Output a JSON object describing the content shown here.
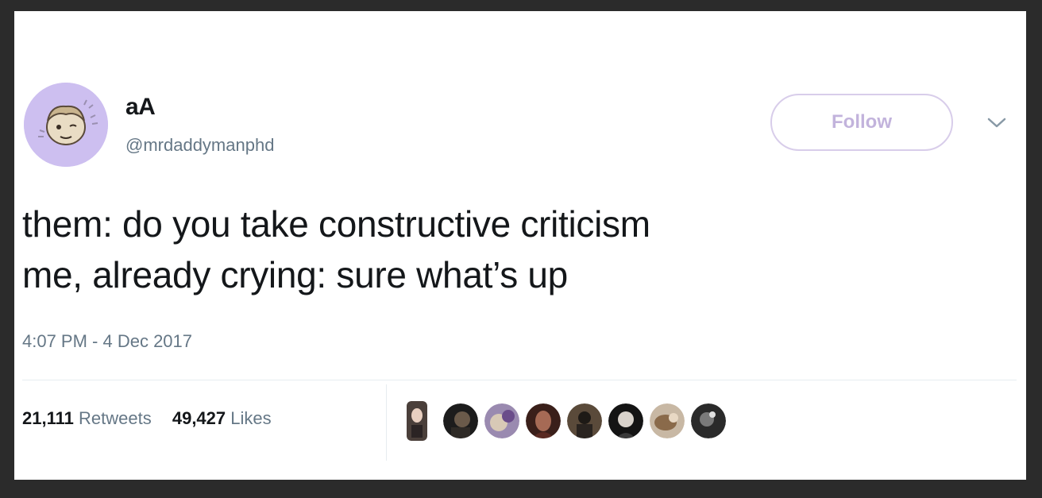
{
  "tweet": {
    "display_name": "aA",
    "handle": "@mrdaddymanphd",
    "follow_label": "Follow",
    "text_lines": [
      "them: do you take constructive criticism",
      "me, already crying: sure what’s up"
    ],
    "timestamp": "4:07 PM - 4 Dec 2017",
    "retweets_count": "21,111",
    "retweets_label": "Retweets",
    "likes_count": "49,427",
    "likes_label": "Likes"
  },
  "icons": {
    "more": "chevron-down-icon"
  },
  "colors": {
    "avatar_bg": "#cdbff0",
    "follow_border": "#d8cdea",
    "follow_text": "#c2b3dc",
    "muted_text": "#657786",
    "body_text": "#14171a"
  }
}
